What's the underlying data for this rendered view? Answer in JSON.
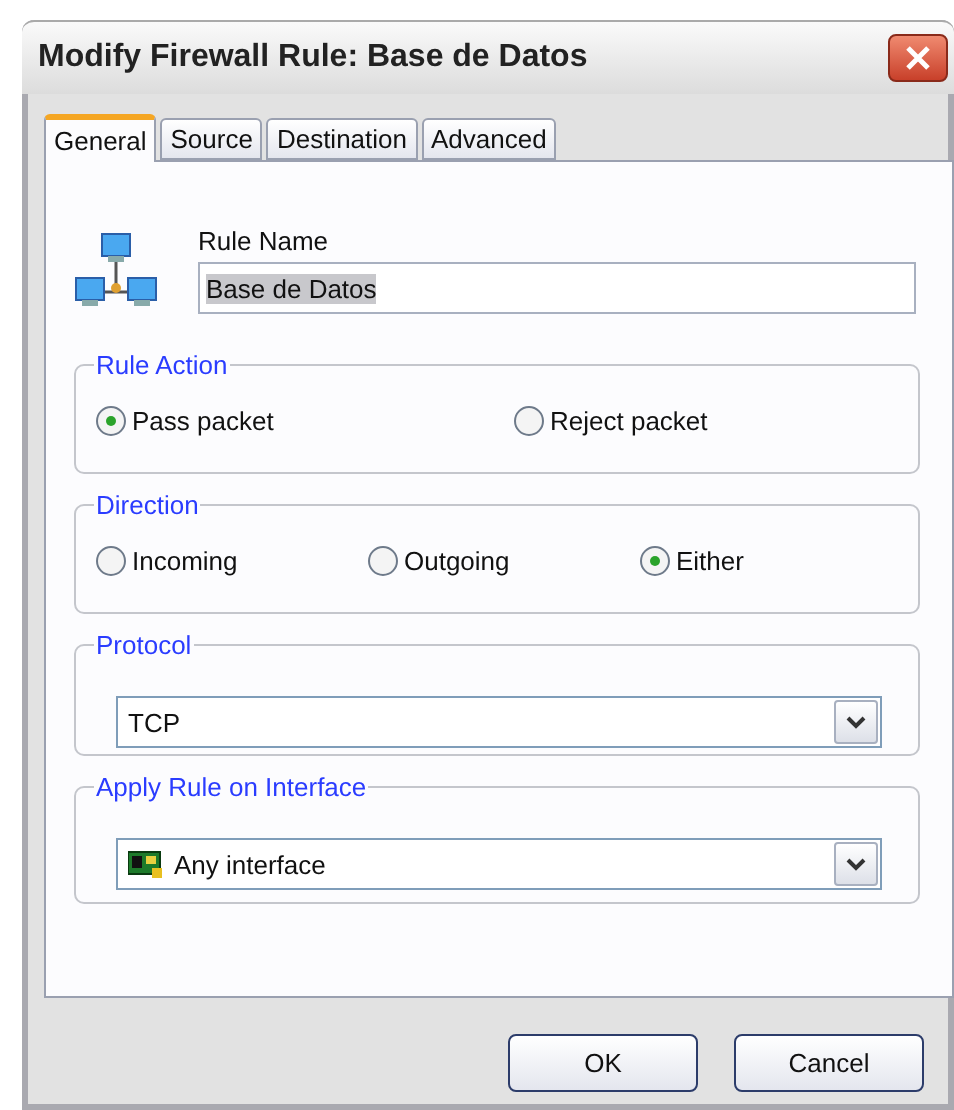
{
  "window": {
    "title": "Modify Firewall Rule: Base de Datos"
  },
  "tabs": [
    {
      "label": "General",
      "selected": true
    },
    {
      "label": "Source",
      "selected": false
    },
    {
      "label": "Destination",
      "selected": false
    },
    {
      "label": "Advanced",
      "selected": false
    }
  ],
  "rule_name": {
    "label": "Rule Name",
    "value": "Base de Datos"
  },
  "rule_action": {
    "title": "Rule Action",
    "options": [
      {
        "label": "Pass packet",
        "selected": true
      },
      {
        "label": "Reject packet",
        "selected": false
      }
    ]
  },
  "direction": {
    "title": "Direction",
    "options": [
      {
        "label": "Incoming",
        "selected": false
      },
      {
        "label": "Outgoing",
        "selected": false
      },
      {
        "label": "Either",
        "selected": true
      }
    ]
  },
  "protocol": {
    "title": "Protocol",
    "value": "TCP"
  },
  "interface": {
    "title": "Apply Rule on Interface",
    "value": "Any interface"
  },
  "buttons": [
    "OK",
    "Cancel"
  ]
}
